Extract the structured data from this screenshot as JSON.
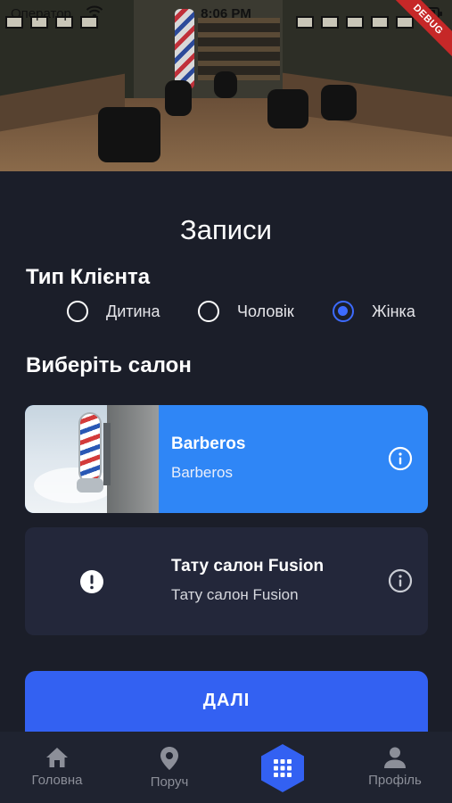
{
  "status_bar": {
    "carrier": "Оператор",
    "time": "8:06 PM"
  },
  "debug_banner": "DEBUG",
  "page": {
    "title": "Записи"
  },
  "client_type": {
    "title": "Тип Клієнта",
    "options": [
      {
        "label": "Дитина",
        "selected": false
      },
      {
        "label": "Чоловік",
        "selected": false
      },
      {
        "label": "Жінка",
        "selected": true
      }
    ]
  },
  "salons": {
    "title": "Виберіть салон",
    "items": [
      {
        "name": "Barberos",
        "subtitle": "Barberos",
        "selected": true,
        "icon": "barber-pole-photo"
      },
      {
        "name": "Тату салон Fusion",
        "subtitle": "Тату салон Fusion",
        "selected": false,
        "icon": "alert-circle-icon"
      }
    ]
  },
  "next_button": {
    "label": "ДАЛІ"
  },
  "bottom_nav": {
    "items": [
      {
        "label": "Головна",
        "icon": "home-icon"
      },
      {
        "label": "Поруч",
        "icon": "location-pin-icon"
      },
      {
        "label": "",
        "icon": "grid-menu-icon"
      },
      {
        "label": "Профіль",
        "icon": "person-icon"
      }
    ]
  },
  "colors": {
    "background": "#1b1e29",
    "accent": "#3361f2",
    "selected_card": "#2f86f6",
    "card": "#23273a",
    "debug": "#c62828"
  }
}
